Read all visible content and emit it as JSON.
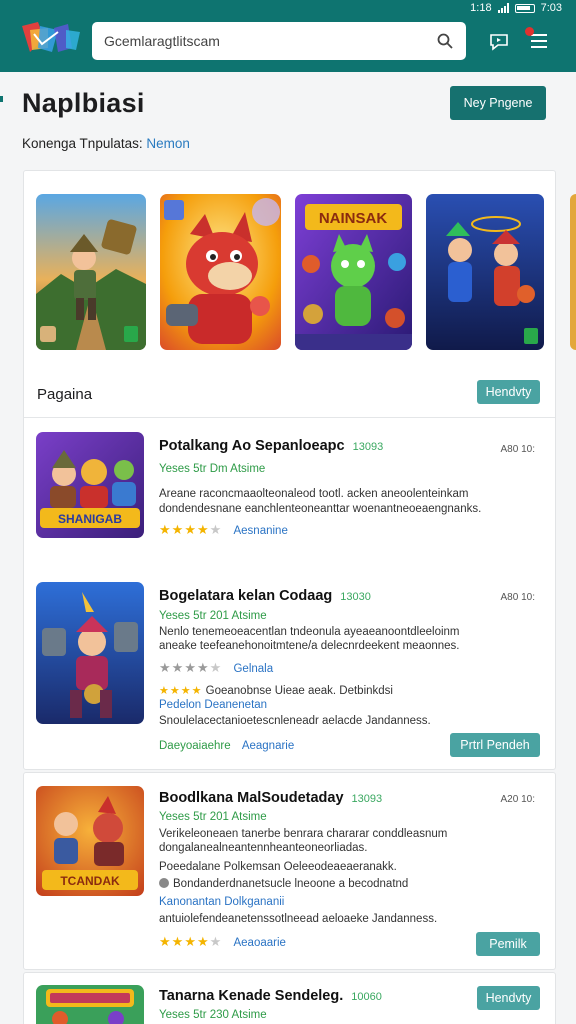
{
  "status": {
    "clock": "1:18",
    "time_right": "7:03"
  },
  "search": {
    "placeholder": "Gcemlaragtlitscam"
  },
  "header": {
    "title": "Naplbiasi",
    "primary_button": "Ney Pngene",
    "subtitle": "Konenga Tnpulatas:",
    "subtitle_link": "Nemon"
  },
  "featured": {
    "cards": [
      "NAINSAK"
    ]
  },
  "section": {
    "title": "Pagaina",
    "button": "Hendvty"
  },
  "items": [
    {
      "title": "Potalkang Ao Sepanloeapc",
      "badge": "13093",
      "meta": "A80 10:",
      "line1": "Yeses 5tr  Dm Atsime",
      "line2": "Areane raconcmaaolteonaleod tootl. acken aneoolenteinkam",
      "line3": "dondendesnane eanchlenteoneanttar woenantneoeaengnanks.",
      "stars_on": 4,
      "action_text": "Aesnanine",
      "thumb_caption": "SHANIGAB"
    },
    {
      "title": "Bogelatara kelan Codaag",
      "badge": "13030",
      "meta": "A80 10:",
      "line1": "Yeses 5tr  201 Atsime",
      "line2": "Nenlo tenemeoeacentlan tndeonula ayeaeanoontdleeloinm",
      "line3": "aneake teefeanehonoitmtene/a  delecnrdeekent meaonnes.",
      "stars_on": 4,
      "action_text": "Gelnala",
      "line4": "Goeanobnse Uieae aeak. Detbinkdsi",
      "line5": "Pedelon Deanenetan",
      "line6": "Snoulelacectanioetescnleneadr aelacde Jandanness.",
      "footer_left": "Daeyoaiaehre",
      "footer_mid": "Aeagnarie",
      "button": "Prtrl Pendeh"
    },
    {
      "title": "Boodlkana MalSoudetaday",
      "badge": "13093",
      "meta": "A20 10:",
      "line1": "Yeses 5tr  201 Atsime",
      "line2": "Verikeleoneaen tanerbe benrara  chararar conddleasnum",
      "line3": "dongalanealneantennheanteoneorliadas.",
      "line4": "Poeedalane Polkemsan Oeleeodeaeaeranakk.",
      "line5": "Bondanderdnanetsucle lneoone a becodnatnd",
      "line6": "Kanonantan   Dolkgananii",
      "line7": "antuiolefendeanetenssotlneead aeloaeke Jandanness.",
      "stars_on": 4,
      "action_text": "Aeaoaarie",
      "button": "Pemilk",
      "thumb_caption": "TCANDAK"
    },
    {
      "title": "Tanarna Kenade Sendeleg.",
      "badge": "10060",
      "line1": "Yeses 5tr  230 Atsime",
      "button": "Hendvty"
    }
  ],
  "colors": {
    "brand": "#0e7470",
    "accent_button": "#4aa3a2",
    "link": "#2a73c4",
    "star": "#f4b400"
  }
}
